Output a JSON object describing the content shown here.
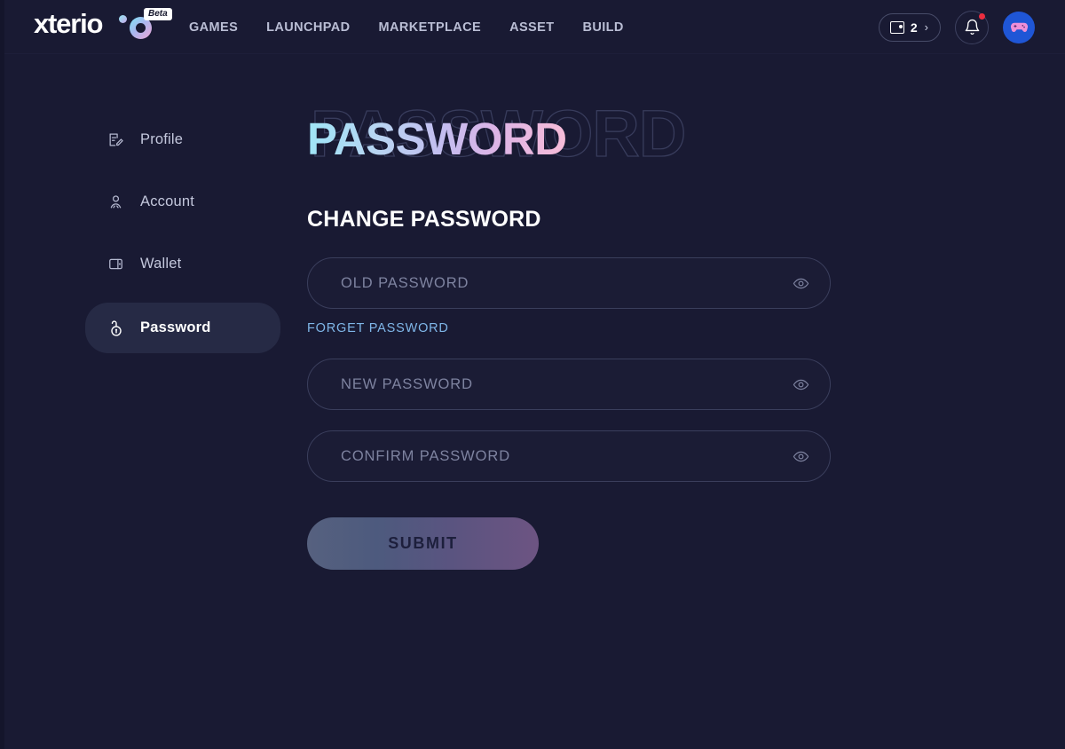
{
  "brand": {
    "name": "xterio",
    "badge": "Beta",
    "logo_gradient_from": "#7fe4f5",
    "logo_gradient_to": "#f0a8d8"
  },
  "nav": {
    "items": [
      {
        "label": "GAMES"
      },
      {
        "label": "LAUNCHPAD"
      },
      {
        "label": "MARKETPLACE"
      },
      {
        "label": "ASSET"
      },
      {
        "label": "BUILD"
      }
    ]
  },
  "header_right": {
    "wallet": {
      "count": "2",
      "chevron": "›"
    },
    "notifications": {
      "has_unread": true,
      "dot_color": "#ec2d3f"
    },
    "avatar": {
      "background": "#1f56d6",
      "icon": "gamepad-icon"
    }
  },
  "sidebar": {
    "items": [
      {
        "label": "Profile",
        "icon": "profile-edit-icon",
        "active": false
      },
      {
        "label": "Account",
        "icon": "person-icon",
        "active": false
      },
      {
        "label": "Wallet",
        "icon": "wallet-icon",
        "active": false
      },
      {
        "label": "Password",
        "icon": "unlock-icon",
        "active": true
      }
    ]
  },
  "main": {
    "page_title": "PASSWORD",
    "ghost_title": "PASSWORD",
    "section_title": "CHANGE PASSWORD",
    "fields": [
      {
        "name": "old-password",
        "placeholder": "OLD PASSWORD",
        "value": "",
        "eye_icon": "eye-icon"
      },
      {
        "name": "new-password",
        "placeholder": "NEW PASSWORD",
        "value": "",
        "eye_icon": "eye-icon"
      },
      {
        "name": "confirm-password",
        "placeholder": "CONFIRM PASSWORD",
        "value": "",
        "eye_icon": "eye-icon"
      }
    ],
    "forget_link": "FORGET PASSWORD",
    "submit_label": "SUBMIT"
  },
  "theme": {
    "background": "#191a33",
    "accent_cyan": "#9fe5f7",
    "accent_pink": "#f7bcd8",
    "link_blue": "#7fb6e8",
    "active_pill": "#262a45"
  }
}
